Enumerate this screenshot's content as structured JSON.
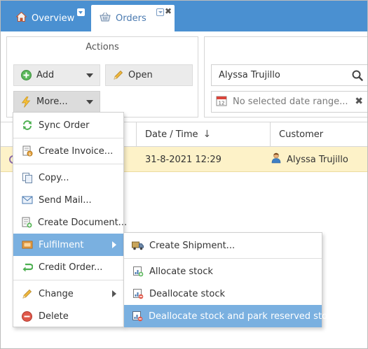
{
  "tabs": [
    {
      "label": "Overview",
      "icon": "home-icon"
    },
    {
      "label": "Orders",
      "icon": "basket-icon"
    }
  ],
  "actions": {
    "title": "Actions",
    "add_label": "Add",
    "open_label": "Open",
    "more_label": "More..."
  },
  "filters": {
    "search_value": "Alyssa Trujillo",
    "date_placeholder": "No selected date range..."
  },
  "grid": {
    "columns": {
      "date": "Date / Time",
      "customer": "Customer"
    },
    "rows": [
      {
        "date": "31-8-2021 12:29",
        "customer": "Alyssa Trujillo"
      }
    ]
  },
  "more_menu": {
    "items": [
      {
        "label": "Sync Order",
        "icon": "sync-icon"
      },
      {
        "label": "Create Invoice...",
        "icon": "invoice-icon"
      },
      {
        "label": "Copy...",
        "icon": "copy-icon"
      },
      {
        "label": "Send Mail...",
        "icon": "mail-icon"
      },
      {
        "label": "Create Document...",
        "icon": "document-icon"
      },
      {
        "label": "Fulfilment",
        "icon": "fulfilment-icon",
        "submenu": true,
        "active": true
      },
      {
        "label": "Credit Order...",
        "icon": "credit-icon"
      },
      {
        "label": "Change",
        "icon": "pencil-icon",
        "submenu": true
      },
      {
        "label": "Delete",
        "icon": "delete-icon"
      }
    ]
  },
  "fulfilment_menu": {
    "items": [
      {
        "label": "Create Shipment...",
        "icon": "truck-icon"
      },
      {
        "label": "Allocate stock",
        "icon": "allocate-icon"
      },
      {
        "label": "Deallocate stock",
        "icon": "deallocate-icon"
      },
      {
        "label": "Deallocate stock and park reserved stock",
        "icon": "deallocate-park-icon",
        "active": true
      }
    ]
  },
  "colors": {
    "tab_bar": "#4a90d1",
    "row_highlight": "#fdf2c8",
    "menu_active": "#7ab0e0"
  }
}
